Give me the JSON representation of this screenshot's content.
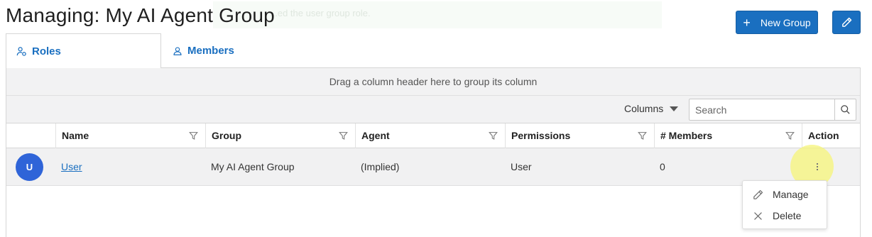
{
  "page": {
    "title": "Managing: My AI Agent Group",
    "ghost_notice": "...ed the user group role."
  },
  "header_actions": {
    "new_group_label": "New Group",
    "new_group_icon": "plus-icon",
    "edit_icon": "pencil-icon",
    "accent_color": "#1a6fc0"
  },
  "tabs": [
    {
      "label": "Roles",
      "icon": "role-user-icon",
      "active": true
    },
    {
      "label": "Members",
      "icon": "user-icon",
      "active": false
    }
  ],
  "grid": {
    "group_panel_hint": "Drag a column header here to group its column",
    "columns_button_label": "Columns",
    "search_placeholder": "Search",
    "columns": [
      "Name",
      "Group",
      "Agent",
      "Permissions",
      "# Members",
      "Action"
    ],
    "rows": [
      {
        "avatar_initial": "U",
        "avatar_color": "#2f64d8",
        "name": "User",
        "group": "My AI Agent Group",
        "agent": "(Implied)",
        "permissions": "User",
        "members": "0"
      }
    ]
  },
  "action_menu": {
    "items": [
      {
        "label": "Manage",
        "icon": "pencil-icon"
      },
      {
        "label": "Delete",
        "icon": "close-icon"
      }
    ]
  }
}
